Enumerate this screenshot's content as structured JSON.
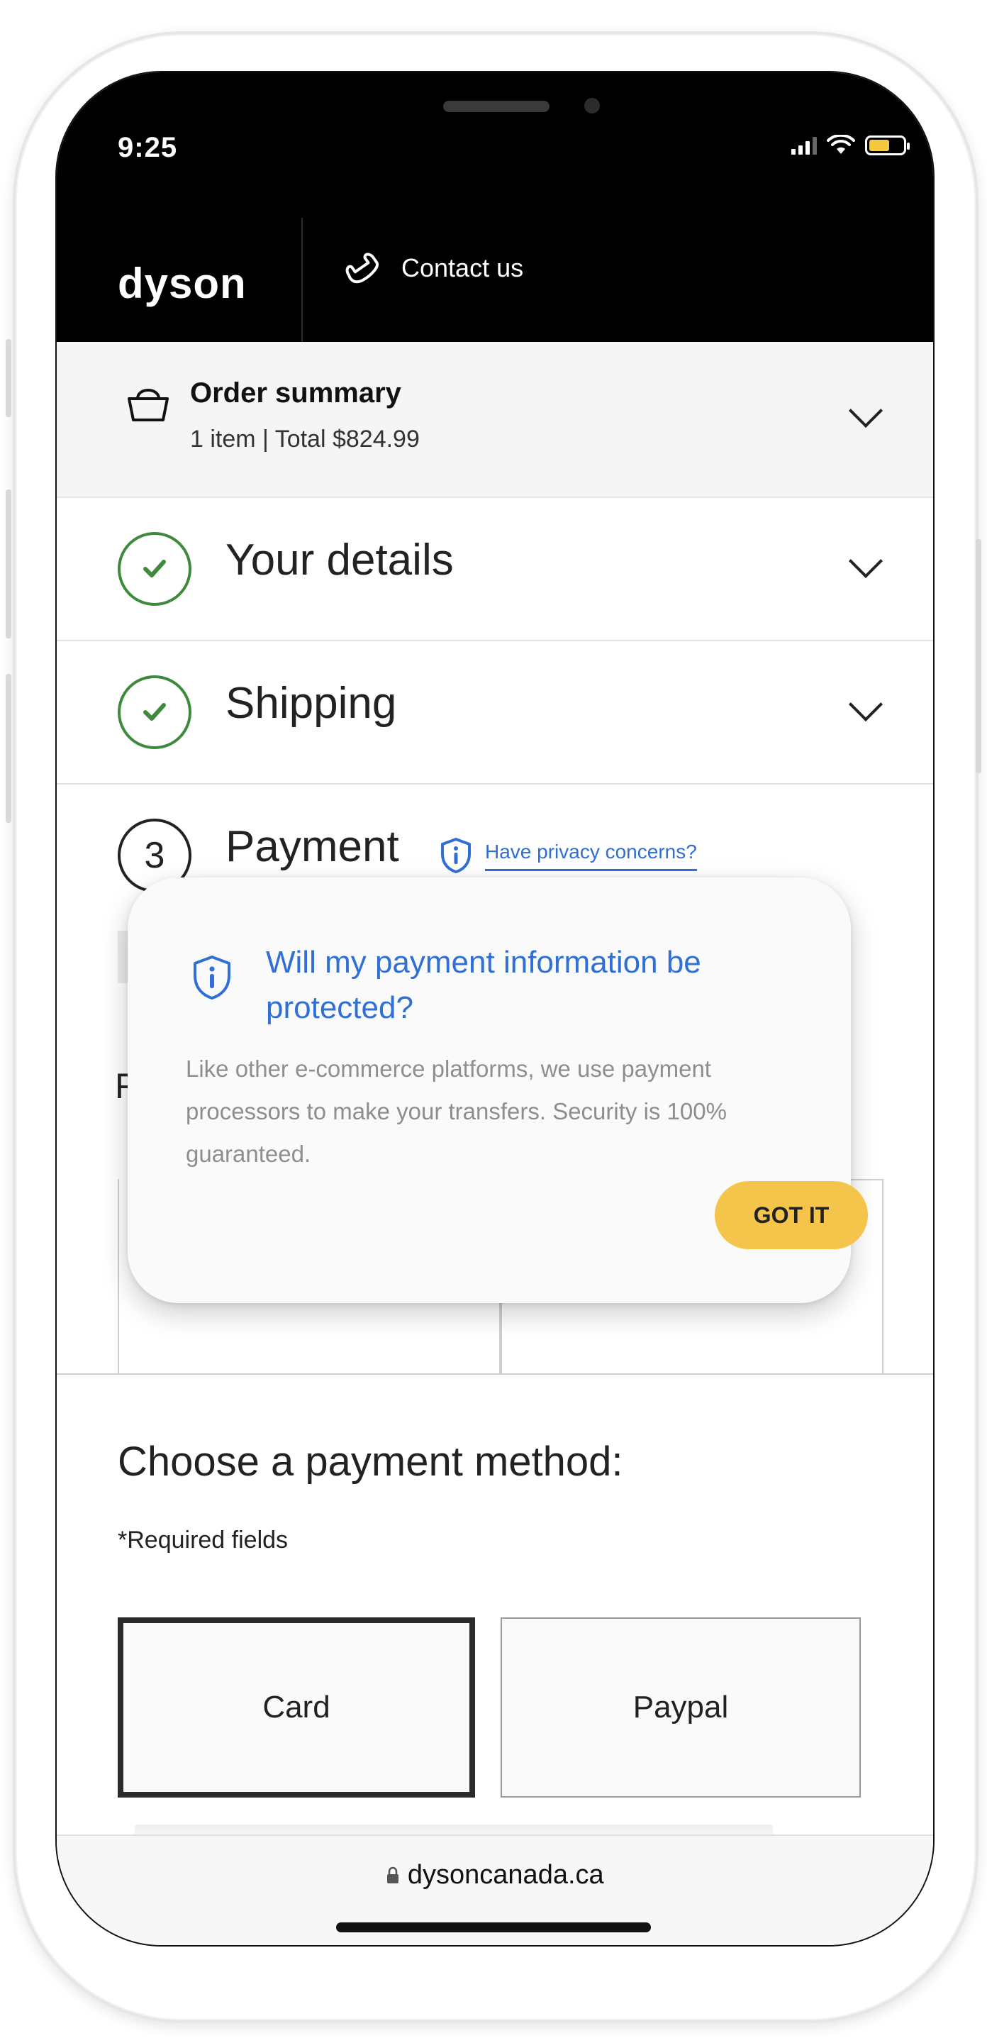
{
  "status_bar": {
    "time": "9:25"
  },
  "header": {
    "logo": "dyson",
    "contact_label": "Contact us"
  },
  "order_summary": {
    "title": "Order summary",
    "subtitle": "1 item | Total $824.99"
  },
  "steps": {
    "details": {
      "label": "Your details",
      "state": "complete"
    },
    "shipping": {
      "label": "Shipping",
      "state": "complete"
    },
    "payment": {
      "number": "3",
      "label": "Payment",
      "privacy_link": "Have privacy concerns?"
    }
  },
  "background_partial": {
    "letter": "F"
  },
  "popup": {
    "title": "Will my payment information be protected?",
    "body": "Like other e-commerce platforms, we use payment processors to make your transfers. Security is 100% guaranteed.",
    "button": "GOT IT"
  },
  "payment_method": {
    "title": "Choose a payment method:",
    "required_note": "*Required fields",
    "options": [
      {
        "label": "Card",
        "selected": true
      },
      {
        "label": "Paypal",
        "selected": false
      }
    ]
  },
  "url_bar": {
    "url": "dysoncanada.ca"
  },
  "colors": {
    "accent_blue": "#2f6fd6",
    "check_green": "#3d8a3d",
    "button_yellow": "#f5c54b",
    "header_black": "#000000"
  }
}
